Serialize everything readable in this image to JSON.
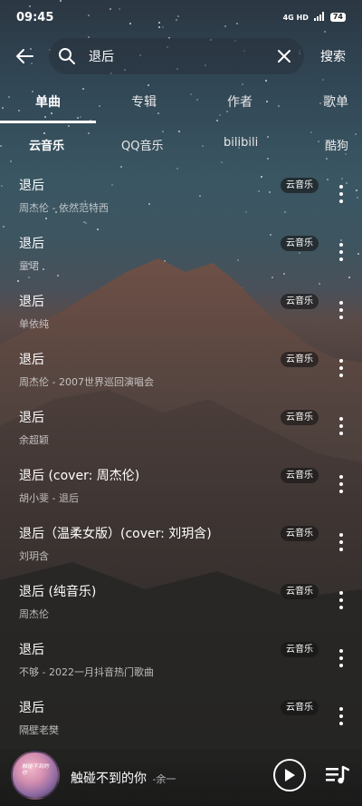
{
  "status_bar": {
    "time": "09:45",
    "network": "4G HD",
    "battery": "74"
  },
  "search": {
    "query": "退后",
    "submit_label": "搜索"
  },
  "tabs": [
    {
      "label": "单曲",
      "active": true
    },
    {
      "label": "专辑",
      "active": false
    },
    {
      "label": "作者",
      "active": false
    },
    {
      "label": "歌单",
      "active": false
    }
  ],
  "sources": [
    {
      "label": "云音乐",
      "active": true
    },
    {
      "label": "QQ音乐",
      "active": false
    },
    {
      "label": "bilibili",
      "active": false
    },
    {
      "label": "酷狗",
      "active": false
    }
  ],
  "results": [
    {
      "title": "退后",
      "subtitle": "周杰伦 - 依然范特西",
      "badge": "云音乐"
    },
    {
      "title": "退后",
      "subtitle": "童珺",
      "badge": "云音乐"
    },
    {
      "title": "退后",
      "subtitle": "单依纯",
      "badge": "云音乐"
    },
    {
      "title": "退后",
      "subtitle": "周杰伦 - 2007世界巡回演唱会",
      "badge": "云音乐"
    },
    {
      "title": "退后",
      "subtitle": "余超颖",
      "badge": "云音乐"
    },
    {
      "title": "退后 (cover: 周杰伦)",
      "subtitle": "胡小斐 - 退后",
      "badge": "云音乐"
    },
    {
      "title": "退后（温柔女版）(cover: 刘玥含)",
      "subtitle": "刘玥含",
      "badge": "云音乐"
    },
    {
      "title": "退后 (纯音乐)",
      "subtitle": "周杰伦",
      "badge": "云音乐"
    },
    {
      "title": "退后",
      "subtitle": "不够 - 2022一月抖音热门歌曲",
      "badge": "云音乐"
    },
    {
      "title": "退后",
      "subtitle": "隔壁老樊",
      "badge": "云音乐"
    }
  ],
  "now_playing": {
    "title": "触碰不到的你",
    "artist": "-余一",
    "cover_text": "触碰不到的你"
  },
  "colors": {
    "accent": "#ffffff",
    "badge_bg": "#1a1a1a"
  }
}
